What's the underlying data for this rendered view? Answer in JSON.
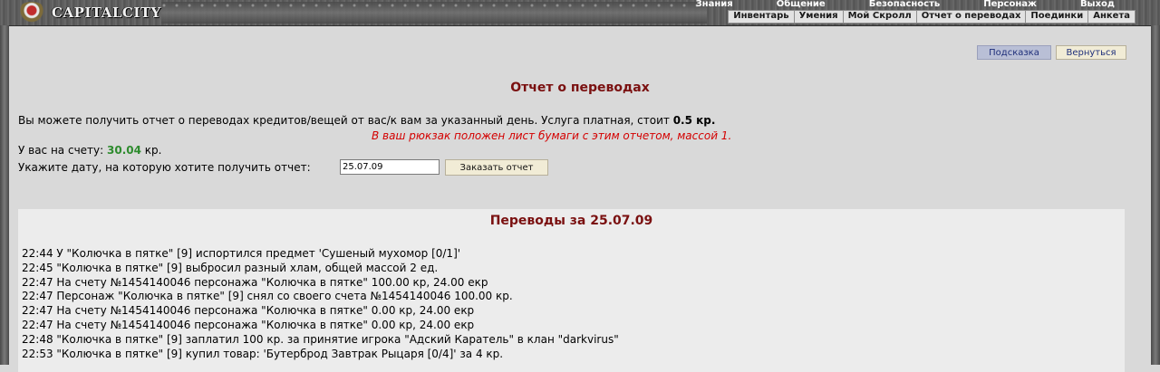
{
  "header": {
    "logo_text": "CAPITALCITY",
    "menu_top": [
      "Знания",
      "Общение",
      "Безопасность",
      "Персонаж",
      "Выход"
    ],
    "menu_sub": [
      "Инвентарь",
      "Умения",
      "Мой Скролл",
      "Отчет о переводах",
      "Поединки",
      "Анкета"
    ]
  },
  "buttons": {
    "hint": "Подсказка",
    "back": "Вернуться",
    "order": "Заказать отчет"
  },
  "page": {
    "title": "Отчет о переводах",
    "intro_text": "Вы можете получить отчет о переводах кредитов/вещей от вас/к вам за указанный день. Услуга платная, стоит ",
    "intro_price": "0.5 кр.",
    "notice": "В ваш рюкзак положен лист бумаги с этим отчетом, массой 1.",
    "balance_label": "У вас на счету: ",
    "balance_value": "30.04",
    "balance_unit": " кр.",
    "date_prompt": "Укажите дату, на которую хотите получить отчет:",
    "date_value": "25.07.09"
  },
  "report": {
    "title": "Переводы за 25.07.09",
    "entries": [
      "22:44 У \"Колючка в пятке\" [9] испортился предмет 'Сушеный мухомор [0/1]'",
      "22:45 \"Колючка в пятке\" [9] выбросил разный хлам, общей массой 2 ед.",
      "22:47 На счету №1454140046 персонажа \"Колючка в пятке\" 100.00 кр, 24.00 екр",
      "22:47 Персонаж \"Колючка в пятке\" [9] снял со своего счета №1454140046 100.00 кр.",
      "22:47 На счету №1454140046 персонажа \"Колючка в пятке\" 0.00 кр, 24.00 екр",
      "22:47 На счету №1454140046 персонажа \"Колючка в пятке\" 0.00 кр, 24.00 екр",
      "22:48 \"Колючка в пятке\" [9] заплатил 100 кр. за принятие игрока \"Адский Каратель\" в клан \"darkvirus\"",
      "22:53 \"Колючка в пятке\" [9] купил товар: 'Бутерброд Завтрак Рыцаря [0/4]' за 4 кр."
    ]
  },
  "colors": {
    "title_red": "#7a1010",
    "notice_red": "#d40000",
    "balance_green": "#2e8b2e"
  }
}
